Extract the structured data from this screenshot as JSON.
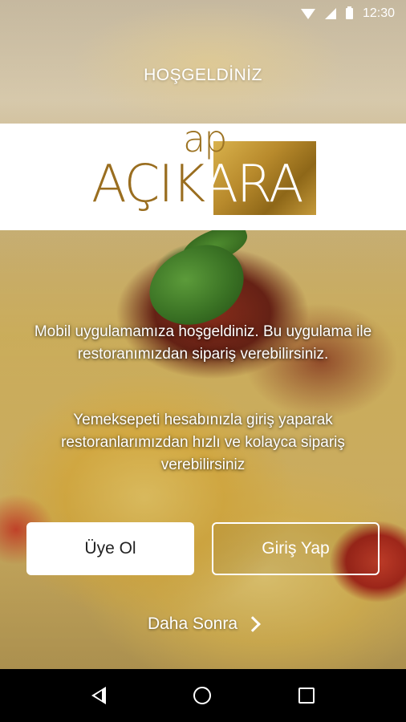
{
  "status_bar": {
    "time": "12:30",
    "icons": [
      "wifi-icon",
      "signal-icon",
      "battery-icon"
    ]
  },
  "header": {
    "title": "HOŞGELDİNİZ"
  },
  "logo": {
    "superscript": "ap",
    "part_dark": "AÇIK",
    "part_light": "ARA",
    "accent_color": "#b88a2c"
  },
  "messages": {
    "intro": "Mobil uygulamamıza hoşgeldiniz. Bu uygulama ile restoranımızdan sipariş verebilirsiniz.",
    "yemeksepeti": "Yemeksepeti hesabınızla giriş yaparak restoranlarımızdan hızlı ve kolayca sipariş verebilirsiniz"
  },
  "buttons": {
    "register": "Üye Ol",
    "login": "Giriş Yap",
    "later": "Daha Sonra"
  },
  "nav_bar": {
    "icons": [
      "back-icon",
      "home-icon",
      "recents-icon"
    ]
  }
}
